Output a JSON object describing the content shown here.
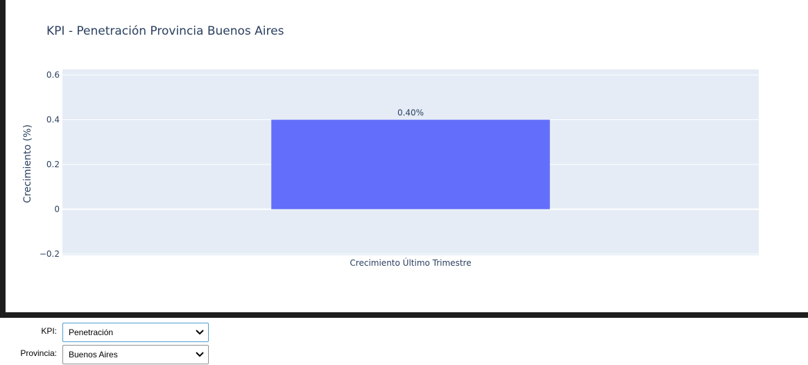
{
  "chart_data": {
    "type": "bar",
    "title": "KPI - Penetración Provincia Buenos Aires",
    "categories": [
      "Crecimiento Último Trimestre"
    ],
    "values": [
      0.4
    ],
    "data_labels": [
      "0.40%"
    ],
    "xlabel": "",
    "ylabel": "Crecimiento (%)",
    "ylim": [
      -0.2,
      0.6
    ],
    "yticks": [
      -0.2,
      0,
      0.2,
      0.4,
      0.6
    ],
    "ytick_labels": [
      "−0.2",
      "0",
      "0.2",
      "0.4",
      "0.6"
    ],
    "grid": true,
    "bar_color": "#636efa",
    "plot_bg": "#e5ecf6",
    "text_color": "#2a3f5f"
  },
  "controls": {
    "kpi": {
      "label": "KPI:",
      "value": "Penetración"
    },
    "provincia": {
      "label": "Provincia:",
      "value": "Buenos Aires"
    }
  }
}
